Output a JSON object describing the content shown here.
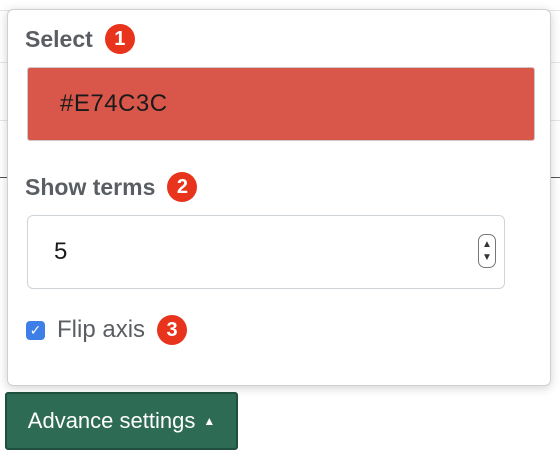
{
  "select": {
    "label": "Select",
    "badge": "1",
    "color_value": "#E74C3C",
    "swatch_color": "#d9574a"
  },
  "show_terms": {
    "label": "Show terms",
    "badge": "2",
    "value": "5"
  },
  "flip_axis": {
    "label": "Flip axis",
    "badge": "3",
    "checked": true
  },
  "advance_button": {
    "label": "Advance settings",
    "caret": "▲"
  },
  "icons": {
    "stepper_up": "▲",
    "stepper_down": "▼",
    "check": "✓"
  },
  "colors": {
    "badge": "#e8341c",
    "button_bg": "#2e6b55",
    "checkbox": "#3d7fe6"
  }
}
